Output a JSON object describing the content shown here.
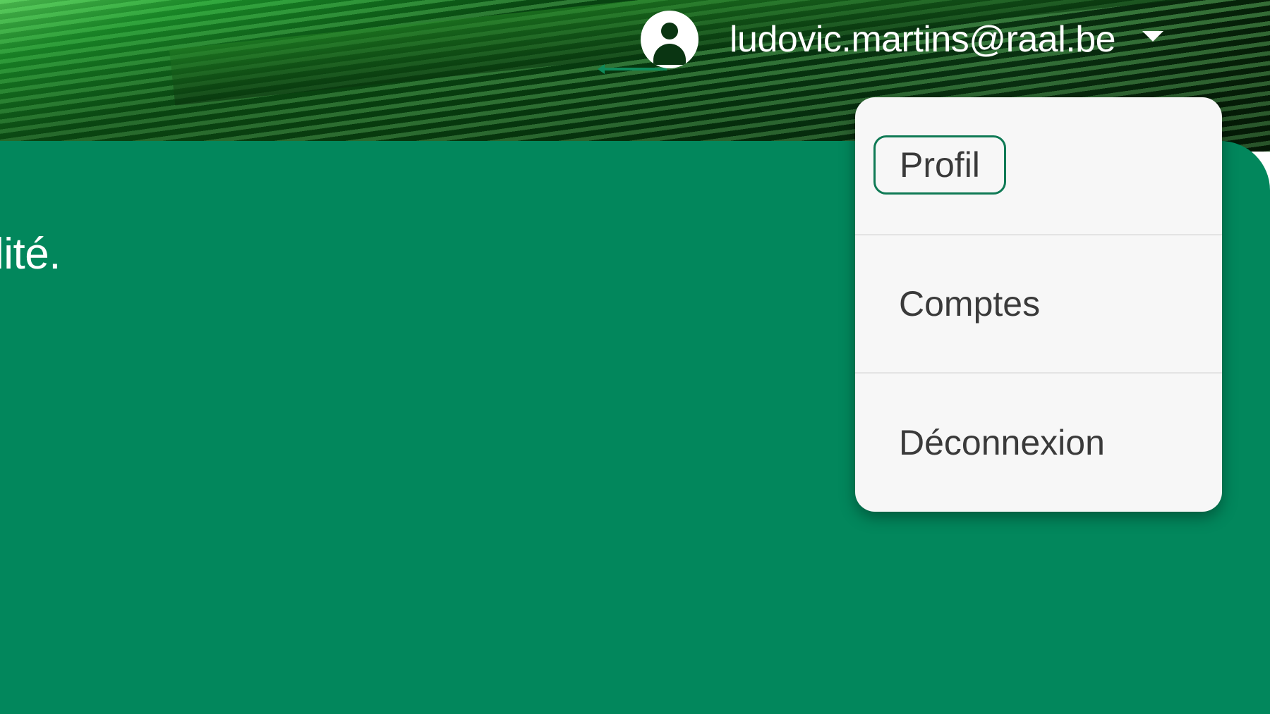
{
  "header": {
    "user_email": "ludovic.martins@raal.be",
    "avatar_icon": "user-circle-icon",
    "dropdown_icon": "caret-down-icon"
  },
  "main": {
    "text_fragment": "lité."
  },
  "user_menu": {
    "items": [
      {
        "label": "Profil",
        "focused": true
      },
      {
        "label": "Comptes",
        "focused": false
      },
      {
        "label": "Déconnexion",
        "focused": false
      }
    ]
  },
  "colors": {
    "panel_green": "#02875c",
    "focus_outline": "#0f7a55",
    "menu_bg": "#f7f7f7",
    "menu_text": "#3a3a3a"
  }
}
